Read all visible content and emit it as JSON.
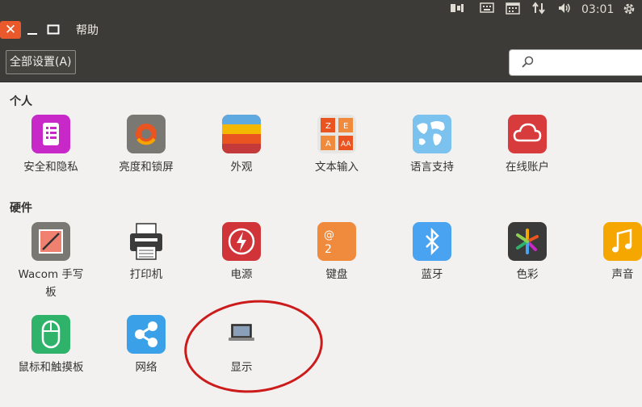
{
  "top_panel": {
    "clock": "03:01",
    "indicators": [
      "tray-icon",
      "keyboard-icon",
      "calendar-icon",
      "network-icon",
      "volume-icon",
      "gear-icon"
    ]
  },
  "title_bar": {
    "close_symbol": "✕",
    "min_symbol": "—",
    "menu_help": "帮助"
  },
  "toolbar": {
    "all_settings_label": "全部设置(A)",
    "search_value": ""
  },
  "sections": {
    "personal": {
      "title": "个人",
      "items": [
        {
          "label": "安全和隐私",
          "icon": "security-privacy-icon",
          "color": "#c928c9"
        },
        {
          "label": "亮度和锁屏",
          "icon": "brightness-lock-icon",
          "color": "#7a7873"
        },
        {
          "label": "外观",
          "icon": "appearance-icon",
          "color": "#e95420"
        },
        {
          "label": "文本输入",
          "icon": "text-entry-icon",
          "color": "#e8e6e3"
        },
        {
          "label": "语言支持",
          "icon": "language-support-icon",
          "color": "#63b4e6"
        },
        {
          "label": "在线账户",
          "icon": "online-accounts-icon",
          "color": "#d83b3b"
        }
      ]
    },
    "hardware": {
      "title": "硬件",
      "items": [
        {
          "label": "Wacom 手写\n板",
          "line1": "Wacom 手写",
          "line2": "板",
          "icon": "wacom-tablet-icon",
          "color": "#7a7873"
        },
        {
          "label": "打印机",
          "icon": "printer-icon",
          "color": "#3b3b3b"
        },
        {
          "label": "电源",
          "icon": "power-icon",
          "color": "#d13438"
        },
        {
          "label": "键盘",
          "icon": "keyboard-icon",
          "color": "#f08a3c"
        },
        {
          "label": "蓝牙",
          "icon": "bluetooth-icon",
          "color": "#4aa3f0"
        },
        {
          "label": "色彩",
          "icon": "color-icon",
          "color": "#3a3a3a"
        },
        {
          "label": "声音",
          "icon": "sound-icon",
          "color": "#f5a700"
        },
        {
          "label": "鼠标和触摸板",
          "icon": "mouse-touchpad-icon",
          "color": "#2fb36b"
        },
        {
          "label": "网络",
          "icon": "network-icon",
          "color": "#3aa0e8"
        },
        {
          "label": "显示",
          "icon": "display-icon",
          "color": "#f2f1f0"
        }
      ]
    }
  }
}
